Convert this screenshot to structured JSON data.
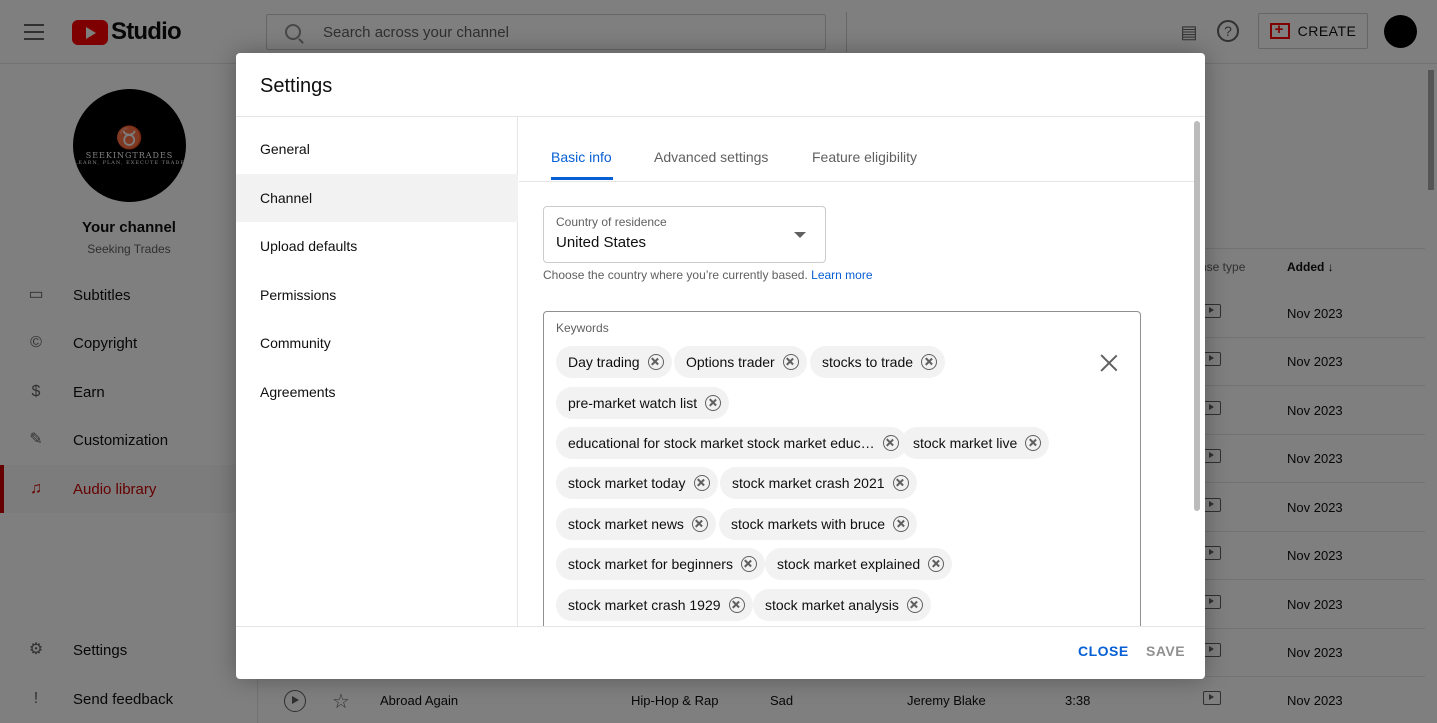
{
  "header": {
    "logo_text": "Studio",
    "search_placeholder": "Search across your channel",
    "create_label": "CREATE"
  },
  "sidebar": {
    "channel_title": "Your channel",
    "channel_name": "Seeking Trades",
    "avatar_text": "SEEKINGTRADES",
    "avatar_tagline": "LEARN, PLAN, EXECUTE TRADE",
    "items": [
      {
        "label": "Subtitles",
        "icon": "subtitles-icon"
      },
      {
        "label": "Copyright",
        "icon": "copyright-icon"
      },
      {
        "label": "Earn",
        "icon": "dollar-icon"
      },
      {
        "label": "Customization",
        "icon": "wand-icon"
      },
      {
        "label": "Audio library",
        "icon": "audio-library-icon"
      }
    ],
    "bottom": [
      {
        "label": "Settings",
        "icon": "gear-icon"
      },
      {
        "label": "Send feedback",
        "icon": "feedback-icon"
      }
    ]
  },
  "table": {
    "headers": {
      "license": "nse type",
      "added": "Added"
    },
    "rows": [
      {
        "added": "Nov 2023"
      },
      {
        "added": "Nov 2023"
      },
      {
        "added": "Nov 2023"
      },
      {
        "added": "Nov 2023"
      },
      {
        "added": "Nov 2023"
      },
      {
        "added": "Nov 2023"
      },
      {
        "added": "Nov 2023"
      },
      {
        "added": "Nov 2023"
      },
      {
        "title": "Abroad Again",
        "genre": "Hip-Hop & Rap",
        "mood": "Sad",
        "artist": "Jeremy Blake",
        "duration": "3:38",
        "added": "Nov 2023"
      }
    ]
  },
  "dialog": {
    "title": "Settings",
    "nav": [
      "General",
      "Channel",
      "Upload defaults",
      "Permissions",
      "Community",
      "Agreements"
    ],
    "tabs": [
      "Basic info",
      "Advanced settings",
      "Feature eligibility"
    ],
    "country": {
      "label": "Country of residence",
      "value": "United States",
      "help": "Choose the country where you’re currently based.",
      "help_link": "Learn more"
    },
    "keywords": {
      "label": "Keywords",
      "chips": [
        "Day trading",
        "Options trader",
        "stocks to trade",
        "pre-market watch list",
        "educational for stock market stock market educ…",
        "stock market live",
        "stock market today",
        "stock market crash 2021",
        "stock market news",
        "stock markets with bruce",
        "stock market for beginners",
        "stock market explained",
        "stock market crash 1929",
        "stock market analysis"
      ]
    },
    "close_label": "CLOSE",
    "save_label": "SAVE"
  }
}
